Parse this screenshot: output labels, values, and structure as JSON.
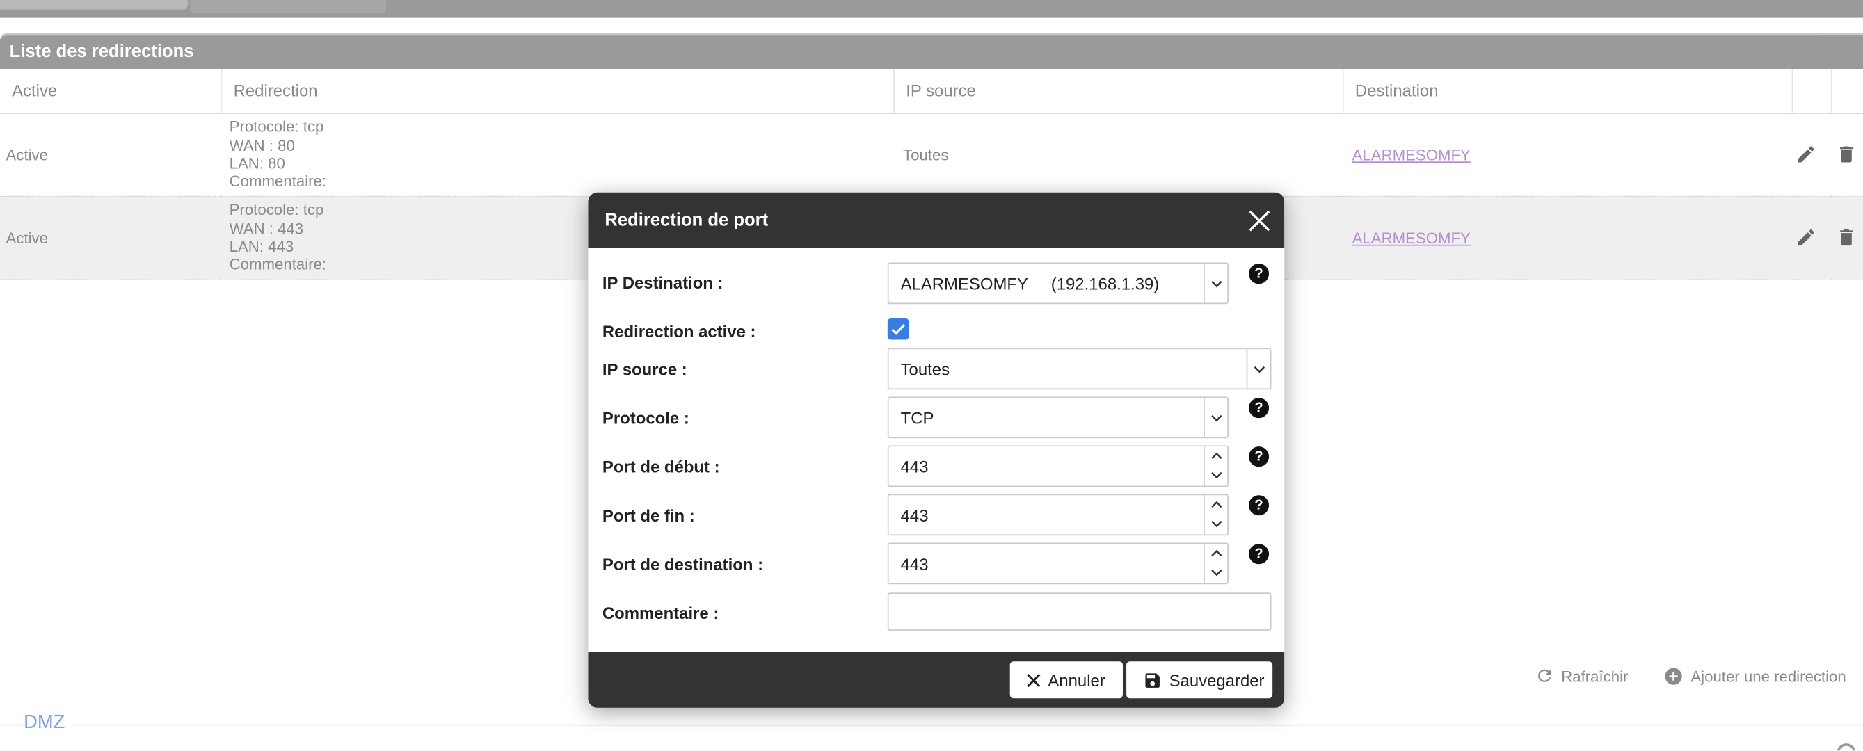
{
  "panel": {
    "title": "Liste des redirections"
  },
  "table": {
    "headers": [
      "Active",
      "Redirection",
      "IP source",
      "Destination"
    ],
    "rows": [
      {
        "active": "Active",
        "protocole": "Protocole: tcp",
        "wan": "WAN : 80",
        "lan": "LAN: 80",
        "commentaire": "Commentaire:",
        "ip_source": "Toutes",
        "destination": "ALARMESOMFY"
      },
      {
        "active": "Active",
        "protocole": "Protocole: tcp",
        "wan": "WAN : 443",
        "lan": "LAN: 443",
        "commentaire": "Commentaire:",
        "ip_source": "",
        "destination": "ALARMESOMFY"
      }
    ]
  },
  "actions": {
    "refresh": "Rafraîchir",
    "add": "Ajouter une redirection"
  },
  "dmz": {
    "label": "DMZ"
  },
  "modal": {
    "title": "Redirection de port",
    "labels": {
      "ip_destination": "IP Destination :",
      "redirection_active": "Redirection active :",
      "ip_source": "IP source :",
      "protocole": "Protocole :",
      "port_debut": "Port de début :",
      "port_fin": "Port de fin :",
      "port_destination": "Port de destination :",
      "commentaire": "Commentaire :"
    },
    "values": {
      "ip_destination": "ALARMESOMFY     (192.168.1.39)",
      "redirection_active": true,
      "ip_source": "Toutes",
      "protocole": "TCP",
      "port_debut": "443",
      "port_fin": "443",
      "port_destination": "443",
      "commentaire": ""
    },
    "help_glyph": "?",
    "buttons": {
      "cancel": "Annuler",
      "save": "Sauvegarder"
    }
  },
  "colors": {
    "header_bg": "#9a9a9a",
    "modal_bg": "#333333",
    "checkbox": "#3b7dde",
    "link": "#b48fd0",
    "dmz": "#7fa1d6"
  },
  "icons": [
    "close-icon",
    "chevron-down-icon",
    "spinner-up-icon",
    "spinner-down-icon",
    "help-icon",
    "check-icon",
    "pencil-icon",
    "trash-icon",
    "refresh-icon",
    "plus-circle-icon",
    "save-icon"
  ]
}
